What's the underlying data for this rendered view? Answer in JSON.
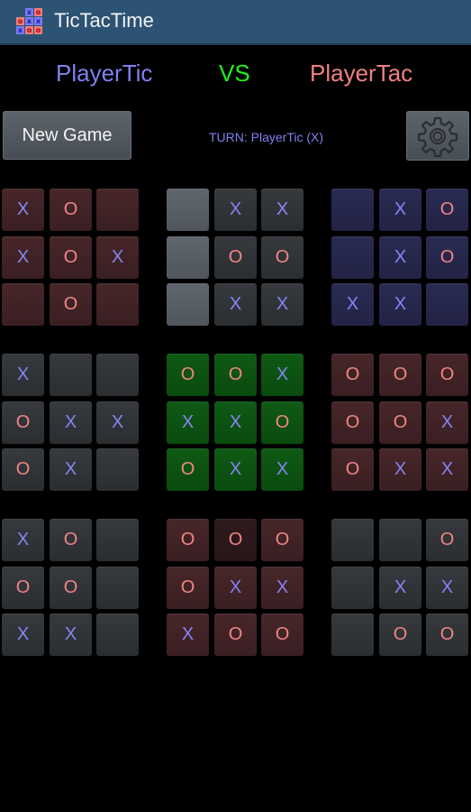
{
  "app": {
    "title": "TicTacTime",
    "icon": "tictactoe-grid-icon"
  },
  "players": {
    "player1": "PlayerTic",
    "vs": "VS",
    "player2": "PlayerTac"
  },
  "colors": {
    "titlebar": "#2d5374",
    "x_color": "#8585f5",
    "o_color": "#f08585",
    "vs_color": "#1cf21c"
  },
  "controls": {
    "new_game_label": "New Game",
    "turn_status": "TURN: PlayerTic (X)",
    "settings_icon": "gear-icon"
  },
  "boards": [
    {
      "id": 1,
      "theme": "red",
      "cells": [
        "X",
        "O",
        "",
        "X",
        "O",
        "X",
        "",
        "O",
        ""
      ]
    },
    {
      "id": 2,
      "theme": "gray-active",
      "cells": [
        "",
        "X",
        "X",
        "",
        "O",
        "O",
        "",
        "X",
        "X"
      ]
    },
    {
      "id": 3,
      "theme": "blue",
      "cells": [
        "",
        "X",
        "O",
        "",
        "X",
        "O",
        "X",
        "X",
        ""
      ]
    },
    {
      "id": 4,
      "theme": "gray",
      "cells": [
        "X",
        "",
        "",
        "O",
        "X",
        "X",
        "O",
        "X",
        ""
      ]
    },
    {
      "id": 5,
      "theme": "green",
      "cells": [
        "O",
        "O",
        "X",
        "X",
        "X",
        "O",
        "O",
        "X",
        "X"
      ]
    },
    {
      "id": 6,
      "theme": "red",
      "cells": [
        "O",
        "O",
        "O",
        "O",
        "O",
        "X",
        "O",
        "X",
        "X"
      ]
    },
    {
      "id": 7,
      "theme": "gray",
      "cells": [
        "X",
        "O",
        "",
        "O",
        "O",
        "",
        "X",
        "X",
        ""
      ]
    },
    {
      "id": 8,
      "theme": "red",
      "cells": [
        "O",
        "O",
        "O",
        "O",
        "X",
        "X",
        "X",
        "O",
        "O"
      ]
    },
    {
      "id": 9,
      "theme": "gray",
      "cells": [
        "",
        "",
        "O",
        "",
        "X",
        "X",
        "",
        "O",
        "O"
      ]
    }
  ]
}
